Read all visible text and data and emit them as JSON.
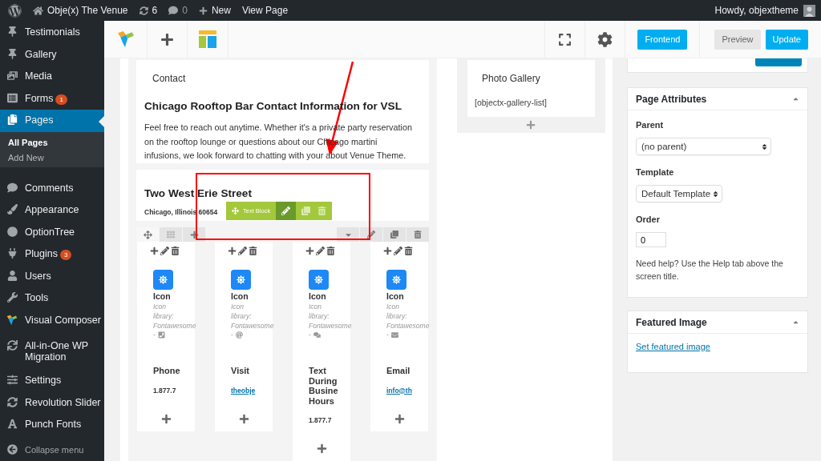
{
  "admin_bar": {
    "site": "Obje(x) The Venue",
    "updates": "6",
    "comments": "0",
    "new": "New",
    "view": "View Page",
    "greeting": "Howdy, objextheme"
  },
  "sidebar": {
    "items": [
      {
        "label": "Testimonials",
        "selected": false
      },
      {
        "label": "Gallery",
        "selected": false
      },
      {
        "label": "Media",
        "selected": false
      },
      {
        "label": "Forms",
        "selected": false,
        "badge": "1"
      },
      {
        "label": "Pages",
        "selected": true,
        "children": [
          {
            "label": "All Pages",
            "selected": true
          },
          {
            "label": "Add New",
            "selected": false
          }
        ]
      },
      {
        "label": "Comments",
        "selected": false
      },
      {
        "label": "Appearance",
        "selected": false
      },
      {
        "label": "OptionTree",
        "selected": false
      },
      {
        "label": "Plugins",
        "selected": false,
        "badge": "3"
      },
      {
        "label": "Users",
        "selected": false
      },
      {
        "label": "Tools",
        "selected": false
      },
      {
        "label": "Visual Composer",
        "selected": false
      },
      {
        "label": "All-in-One WP Migration",
        "selected": false
      },
      {
        "label": "Settings",
        "selected": false
      },
      {
        "label": "Revolution Slider",
        "selected": false
      },
      {
        "label": "Punch Fonts",
        "selected": false
      }
    ],
    "collapse": "Collapse menu"
  },
  "toolbar": {
    "buttons": [
      {
        "label": "Frontend",
        "kind": "primary"
      },
      {
        "label": "Preview",
        "kind": "secondary"
      },
      {
        "label": "Update",
        "kind": "primary"
      }
    ]
  },
  "editor": {
    "contact": {
      "label": "Contact",
      "heading": "Chicago Rooftop Bar Contact Information for VSL",
      "body": "Feel free to reach out anytime. Whether it's a private party reservation on the rooftop lounge or questions about our Chicago martini infusions, we look forward to chatting with your about Venue Theme."
    },
    "address": {
      "heading": "Two West Erie Street",
      "city": "Chicago, Illinois 60654"
    },
    "element_toolbar": {
      "label": "Text Block"
    },
    "columns": [
      {
        "title": "Icon",
        "description": "Icon\nlibrary:\nFontawesome",
        "dash": "-",
        "heading": "Phone",
        "value": "1.877.7",
        "kind": "text"
      },
      {
        "title": "Icon",
        "description": "Icon\nlibrary:\nFontawesome",
        "dash": "-",
        "heading": "Visit",
        "value": "theobje",
        "kind": "link"
      },
      {
        "title": "Icon",
        "description": "Icon\nlibrary:\nFontawesome",
        "dash": "-",
        "heading": "Text During Busine Hours",
        "value": "1.877.7",
        "kind": "text"
      },
      {
        "title": "Icon",
        "description": "Icon\nlibrary:\nFontawesome",
        "dash": "-",
        "heading": "Email",
        "value": "info@th",
        "kind": "link"
      }
    ],
    "gallery": {
      "label": "Photo Gallery",
      "shortcode": "[objectx-gallery-list]"
    }
  },
  "page_attributes": {
    "title": "Page Attributes",
    "parent_label": "Parent",
    "parent": "(no parent)",
    "template_label": "Template",
    "template": "Default Template",
    "order_label": "Order",
    "order": "0",
    "help": "Need help? Use the Help tab above the screen title."
  },
  "featured_image": {
    "title": "Featured Image",
    "link": "Set featured image"
  }
}
